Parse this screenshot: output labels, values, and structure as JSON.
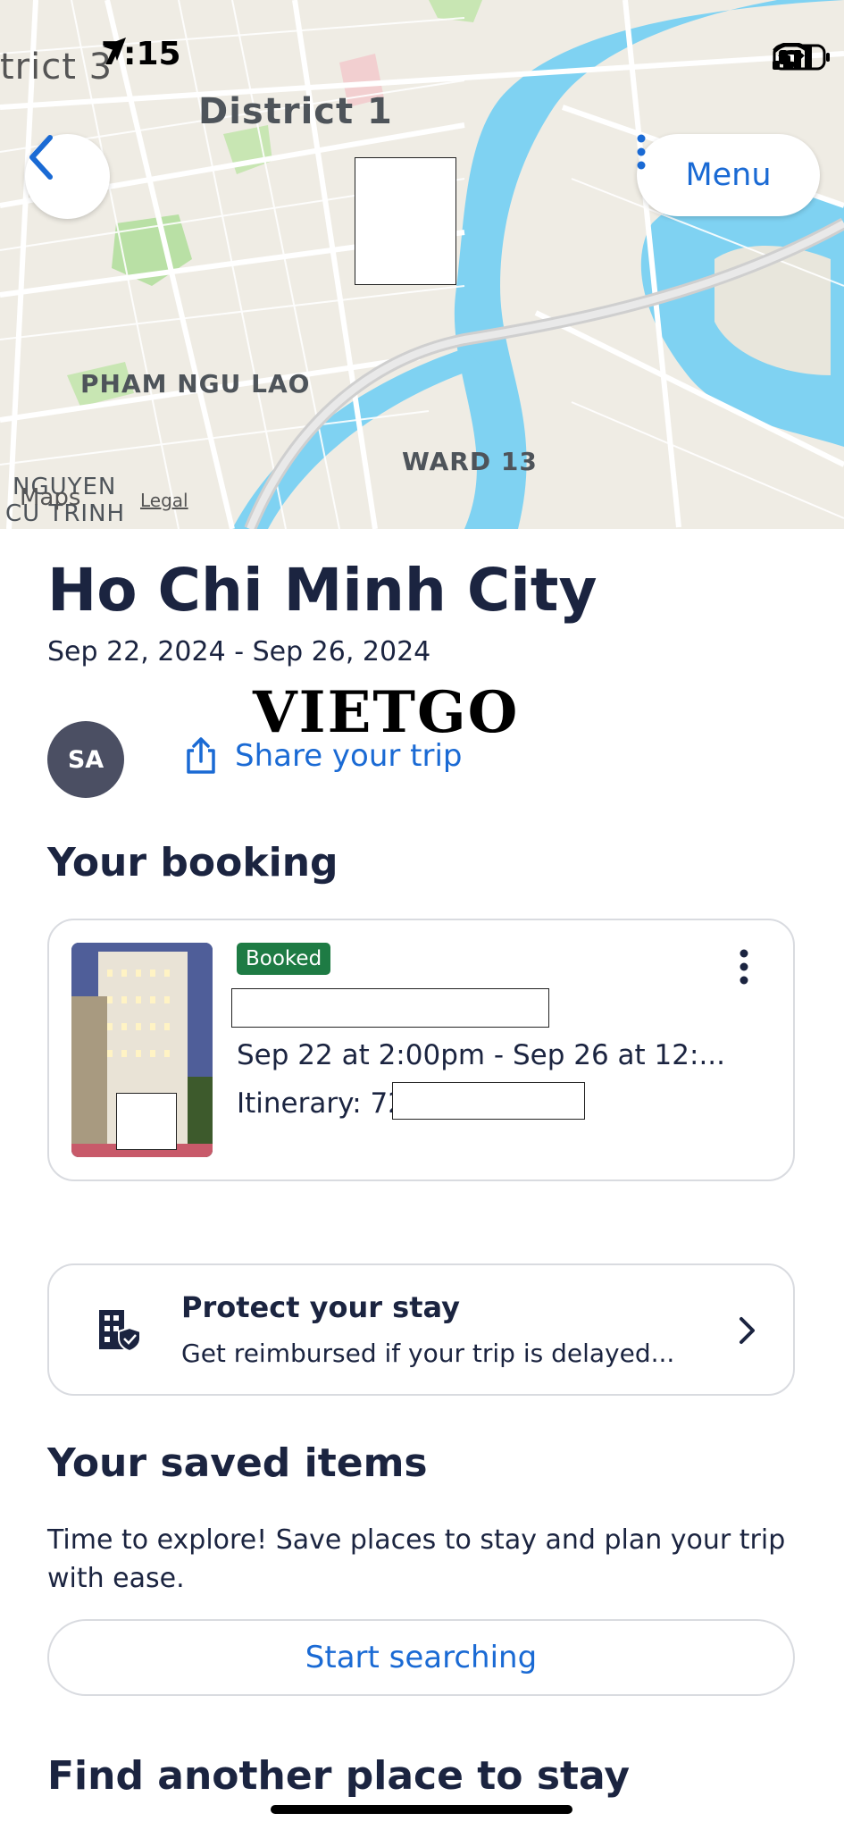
{
  "status_bar": {
    "time": "7:15"
  },
  "map": {
    "labels": {
      "district3": "trict 3",
      "district1": "District 1",
      "pham_ngu_lao": "PHAM NGU LAO",
      "ward13": "WARD 13",
      "nguyen": "NGUYEN",
      "cu_trinh": "CU TRINH"
    },
    "attribution": "Maps",
    "legal": "Legal"
  },
  "header": {
    "menu_label": "Menu"
  },
  "trip": {
    "city": "Ho Chi Minh City",
    "dates": "Sep 22, 2024 - Sep 26, 2024",
    "avatar_initials": "SA",
    "share_label": "Share your trip",
    "watermark": "VIETGO"
  },
  "booking": {
    "heading": "Your booking",
    "status_badge": "Booked",
    "dates": "Sep 22 at 2:00pm - Sep 26 at 12:...",
    "itinerary_prefix": "Itinerary: 72"
  },
  "protect": {
    "title": "Protect your stay",
    "subtitle": "Get reimbursed if your trip is delayed..."
  },
  "saved": {
    "heading": "Your saved items",
    "body": "Time to explore! Save places to stay and plan your trip with ease.",
    "button_label": "Start searching"
  },
  "find": {
    "heading": "Find another place to stay"
  },
  "colors": {
    "accent": "#1a6ad4",
    "badge_green": "#1e7b44",
    "text_dark": "#1b2440",
    "river": "#7fd2f2"
  }
}
